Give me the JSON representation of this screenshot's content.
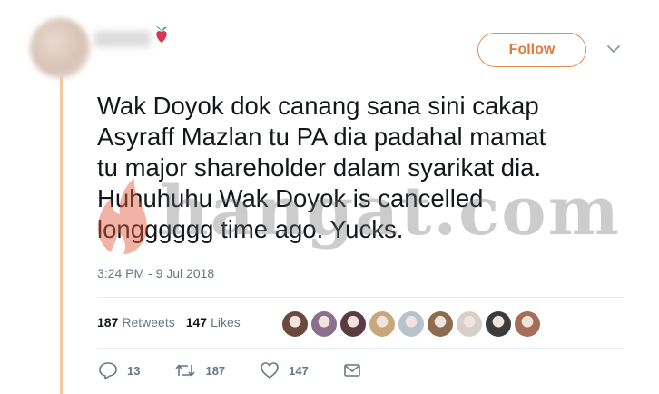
{
  "tweet": {
    "text": "Wak Doyok dok canang sana sini cakap\nAsyraff Mazlan tu PA dia padahal mamat\ntu major shareholder dalam syarikat dia.\nHuhuhuhu Wak Doyok is cancelled\nlongggggg time ago. Yucks.",
    "timestamp": "3:24 PM - 9 Jul 2018"
  },
  "header": {
    "follow_label": "Follow",
    "icons": [
      "user-avatar",
      "emoji-icon",
      "chevron-down-icon"
    ]
  },
  "watermark": {
    "text": "hangat.com"
  },
  "stats": {
    "retweets_count": "187",
    "retweets_label": "Retweets",
    "likes_count": "147",
    "likes_label": "Likes",
    "liker_avatars": [
      "#6b4a3e",
      "#8a6f8f",
      "#5a3b40",
      "#c9a77c",
      "#b8c2cc",
      "#8c6b4f",
      "#d8d0c8",
      "#3c3c3c",
      "#a66d58"
    ]
  },
  "actions": {
    "replies": "13",
    "retweets": "187",
    "likes": "147",
    "icons": [
      "reply-icon",
      "retweet-icon",
      "like-icon",
      "message-icon"
    ]
  },
  "colors": {
    "accent": "#e0783a",
    "thread_line": "#f4c8a0",
    "muted_text": "#657786"
  }
}
